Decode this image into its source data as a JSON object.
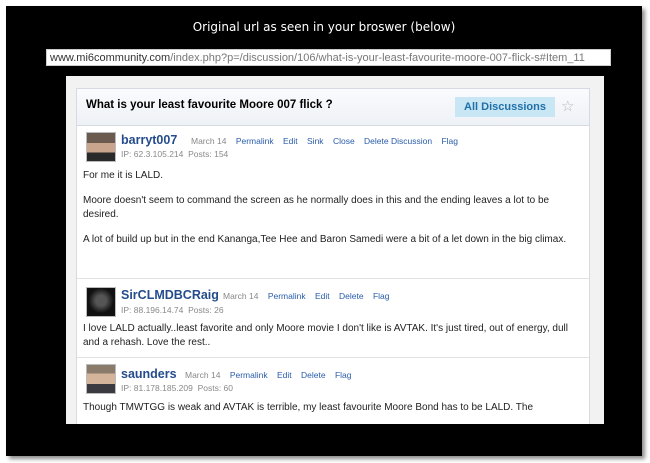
{
  "caption": "Original url as seen in your broswer (below)",
  "url": {
    "domain": "www.mi6community.com",
    "path": "/index.php?p=/discussion/106/what-is-your-least-favourite-moore-007-flick-s#Item_11"
  },
  "discussion": {
    "title": "What is your least favourite Moore 007 flick ?",
    "all_discussions_label": "All Discussions",
    "star_icon": "☆"
  },
  "comments": [
    {
      "author": "barryt007",
      "date": "March 14",
      "links": [
        "Permalink",
        "Edit",
        "Sink",
        "Close",
        "Delete Discussion",
        "Flag"
      ],
      "ip": "IP: 62.3.105.214",
      "posts": "Posts: 154",
      "paragraphs": [
        "For me it is LALD.",
        "Moore doesn't seem to command the screen as he normally does in this and the ending leaves a lot to be desired.",
        "A lot of build up but in the end Kananga,Tee Hee and Baron Samedi were a bit of a let down in the big climax."
      ]
    },
    {
      "author": "SirCLMDBCRaig",
      "date": "March 14",
      "links": [
        "Permalink",
        "Edit",
        "Delete",
        "Flag"
      ],
      "ip": "IP: 88.196.14.74",
      "posts": "Posts: 26",
      "paragraphs": [
        "I love LALD actually..least favorite and only Moore movie I don't like is AVTAK. It's just tired, out of energy, dull and a rehash. Love the rest.."
      ]
    },
    {
      "author": "saunders",
      "date": "March 14",
      "links": [
        "Permalink",
        "Edit",
        "Delete",
        "Flag"
      ],
      "ip": "IP: 81.178.185.209",
      "posts": "Posts: 60",
      "paragraphs": [
        "Though TMWTGG is weak and AVTAK is terrible, my least favourite Moore Bond has to be LALD. The"
      ]
    }
  ]
}
